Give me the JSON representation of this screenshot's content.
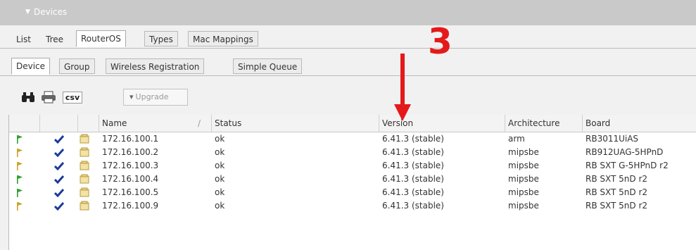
{
  "window": {
    "title": "Devices"
  },
  "tabs_main": [
    {
      "label": "List"
    },
    {
      "label": "Tree"
    },
    {
      "label": "RouterOS"
    },
    {
      "label": "Types"
    },
    {
      "label": "Mac Mappings"
    }
  ],
  "tabs_sub": [
    {
      "label": "Device"
    },
    {
      "label": "Group"
    },
    {
      "label": "Wireless Registration"
    },
    {
      "label": "Simple Queue"
    }
  ],
  "toolbar": {
    "find_icon": "binoculars-icon",
    "print_icon": "printer-icon",
    "csv_label": "csv",
    "upgrade_label": "Upgrade",
    "upgrade_arrow": "▾"
  },
  "table": {
    "columns": [
      "",
      "",
      "",
      "Name",
      "Status",
      "Version",
      "Architecture",
      "Board"
    ],
    "sort_marker": "/",
    "rows": [
      {
        "flag_color": "#2f9e2f",
        "name": "172.16.100.1",
        "status": "ok",
        "version": "6.41.3 (stable)",
        "arch": "arm",
        "board": "RB3011UiAS"
      },
      {
        "flag_color": "#c9a227",
        "name": "172.16.100.2",
        "status": "ok",
        "version": "6.41.3 (stable)",
        "arch": "mipsbe",
        "board": "RB912UAG-5HPnD"
      },
      {
        "flag_color": "#c9a227",
        "name": "172.16.100.3",
        "status": "ok",
        "version": "6.41.3 (stable)",
        "arch": "mipsbe",
        "board": "RB SXT G-5HPnD r2"
      },
      {
        "flag_color": "#2f9e2f",
        "name": "172.16.100.4",
        "status": "ok",
        "version": "6.41.3 (stable)",
        "arch": "mipsbe",
        "board": "RB SXT 5nD r2"
      },
      {
        "flag_color": "#2f9e2f",
        "name": "172.16.100.5",
        "status": "ok",
        "version": "6.41.3 (stable)",
        "arch": "mipsbe",
        "board": "RB SXT 5nD r2"
      },
      {
        "flag_color": "#c9a227",
        "name": "172.16.100.9",
        "status": "ok",
        "version": "6.41.3 (stable)",
        "arch": "mipsbe",
        "board": "RB SXT 5nD r2"
      }
    ]
  },
  "annotation": {
    "number": "3",
    "color": "#e41a1a"
  }
}
